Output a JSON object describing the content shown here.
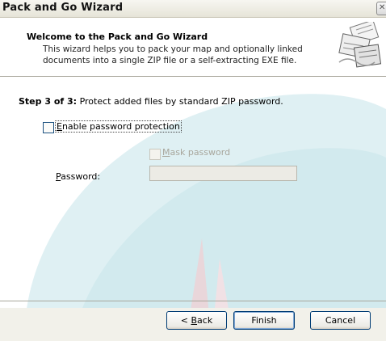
{
  "window": {
    "title": "Pack and Go Wizard"
  },
  "header": {
    "title": "Welcome to the Pack and Go Wizard",
    "description_line1": "This wizard helps you to pack your map and optionally linked",
    "description_line2": "documents into a single ZIP file or a self-extracting EXE file."
  },
  "step": {
    "number": "Step 3 of 3:",
    "text": "Protect added files by standard ZIP password."
  },
  "options": {
    "enable_password": {
      "label_accel": "E",
      "label_rest": "nable password protection",
      "checked": false
    },
    "mask_password": {
      "label_accel": "M",
      "label_rest": "ask password",
      "checked": false,
      "enabled": false
    },
    "password": {
      "label_accel": "P",
      "label_rest": "assword:",
      "value": "",
      "enabled": false
    }
  },
  "buttons": {
    "back_prefix": "< ",
    "back_accel": "B",
    "back_rest": "ack",
    "finish": "Finish",
    "cancel": "Cancel"
  },
  "colors": {
    "title_bar": "#ece9d8",
    "body_bg": "#ffffff",
    "accent": "#003c74",
    "disabled_text": "#a8a69c"
  }
}
